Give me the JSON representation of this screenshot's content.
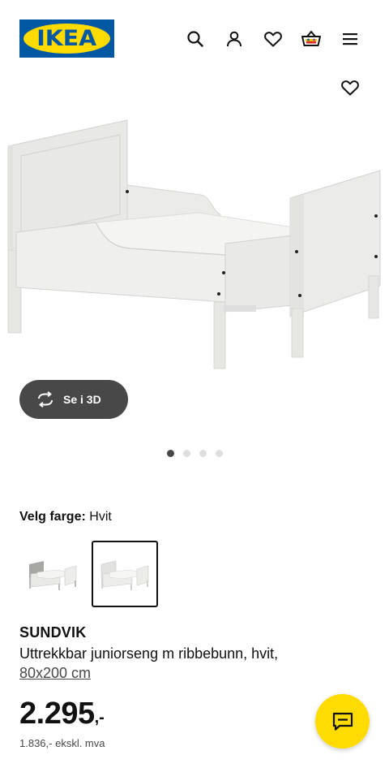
{
  "header": {
    "logo_text": "IKEA",
    "brand_colors": {
      "blue": "#0058A3",
      "yellow": "#FFDB00"
    },
    "icons": [
      "search-icon",
      "user-icon",
      "heart-icon",
      "basket-icon",
      "menu-icon"
    ]
  },
  "gallery": {
    "favorite_icon": "heart-icon",
    "view_3d_label": "Se i 3D",
    "slide_count": 4,
    "active_slide": 1
  },
  "variant": {
    "label": "Velg farge:",
    "selected_value": "Hvit",
    "swatches": [
      "grey-white",
      "white"
    ],
    "selected_index": 1
  },
  "product": {
    "name": "SUNDVIK",
    "description": "Uttrekkbar juniorseng m ribbebunn, hvit,",
    "size": "80x200 cm"
  },
  "pricing": {
    "price": "2.295",
    "price_suffix": ",-",
    "price_excl_vat": "1.836,- ekskl. mva"
  },
  "chat": {
    "icon": "chat-icon",
    "color": "#FFDB00"
  }
}
